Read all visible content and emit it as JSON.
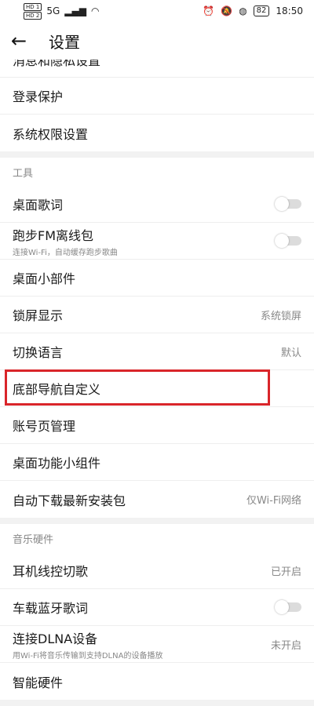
{
  "status": {
    "time": "18:50",
    "battery": "82",
    "sim1": "HD 1",
    "sim2": "HD 2",
    "signal": "5G",
    "wifi": "wifi"
  },
  "header": {
    "title": "设置"
  },
  "top_items": [
    {
      "label": "消息和隐私设置"
    },
    {
      "label": "登录保护"
    },
    {
      "label": "系统权限设置"
    }
  ],
  "sections": {
    "tools": "工具",
    "music_hw": "音乐硬件"
  },
  "tools_items": [
    {
      "label": "桌面歌词",
      "toggle": false
    },
    {
      "label": "跑步FM离线包",
      "sub": "连接Wi-Fi，自动缓存跑步歌曲",
      "toggle": false
    },
    {
      "label": "桌面小部件"
    },
    {
      "label": "锁屏显示",
      "value": "系统锁屏"
    },
    {
      "label": "切换语言",
      "value": "默认"
    },
    {
      "label": "底部导航自定义"
    },
    {
      "label": "账号页管理"
    },
    {
      "label": "桌面功能小组件"
    },
    {
      "label": "自动下载最新安装包",
      "value": "仅Wi-Fi网络"
    }
  ],
  "music_items": [
    {
      "label": "耳机线控切歌",
      "value": "已开启"
    },
    {
      "label": "车载蓝牙歌词",
      "toggle": false
    },
    {
      "label": "连接DLNA设备",
      "sub": "用Wi-Fi将音乐传输到支持DLNA的设备播放",
      "value": "未开启"
    },
    {
      "label": "智能硬件"
    }
  ],
  "colors": {
    "highlight": "#d9252a",
    "divider": "#f2f2f2"
  }
}
